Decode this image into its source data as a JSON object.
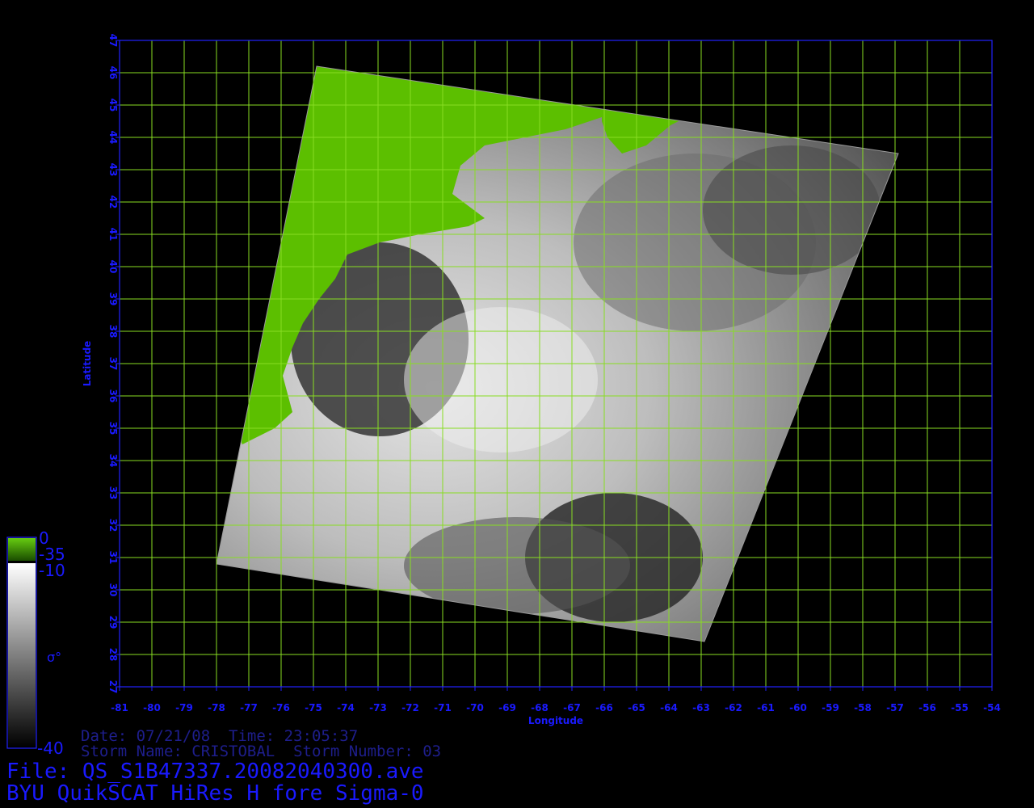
{
  "map": {
    "x_ticks": [
      "-81",
      "-80",
      "-79",
      "-78",
      "-77",
      "-76",
      "-75",
      "-74",
      "-73",
      "-72",
      "-71",
      "-70",
      "-69",
      "-68",
      "-67",
      "-66",
      "-65",
      "-64",
      "-63",
      "-62",
      "-61",
      "-60",
      "-59",
      "-58",
      "-57",
      "-56",
      "-55",
      "-54"
    ],
    "y_ticks": [
      "27",
      "28",
      "29",
      "30",
      "31",
      "32",
      "33",
      "34",
      "35",
      "36",
      "37",
      "38",
      "39",
      "40",
      "41",
      "42",
      "43",
      "44",
      "45",
      "46",
      "47"
    ],
    "xlabel": "Longitude",
    "ylabel": "Latitude",
    "lon_range": [
      -81,
      -54
    ],
    "lat_range": [
      27,
      47
    ],
    "colors": {
      "grid": "#88dd22",
      "frame": "#2222ff",
      "land": "#55bb00",
      "ocean_dark": "#2a2a2a",
      "ocean_light": "#dcdcdc"
    },
    "swath_corners": [
      {
        "lon": -74.9,
        "lat": 46.2
      },
      {
        "lon": -56.9,
        "lat": 43.5
      },
      {
        "lon": -62.9,
        "lat": 28.4
      },
      {
        "lon": -78.0,
        "lat": 30.8
      }
    ]
  },
  "colorbar": {
    "labels": {
      "top": "0",
      "land_min": "-35",
      "ocean_max": "-10",
      "symbol": "σ°",
      "bottom": "-40"
    }
  },
  "info": {
    "date_line": "Date: 07/21/08  Time: 23:05:37",
    "storm_line": "Storm Name: CRISTOBAL  Storm Number: 03",
    "file_line": "File: QS_S1B47337.20082040300.ave",
    "title_line": "BYU QuikSCAT HiRes H fore Sigma-0"
  }
}
